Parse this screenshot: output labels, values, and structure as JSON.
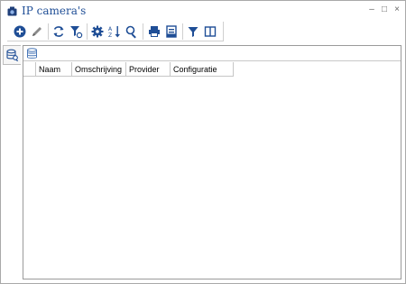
{
  "window": {
    "title": "IP camera's",
    "title_icon": "camera-icon",
    "controls": [
      "minimize-icon",
      "maximize-icon",
      "close-icon"
    ]
  },
  "toolbar": {
    "buttons": [
      "add-icon",
      "edit-icon",
      "refresh-icon",
      "filter-settings-icon",
      "settings-icon",
      "sort-az-icon",
      "search-icon",
      "print-icon",
      "print-preview-icon",
      "filter-icon",
      "columns-icon"
    ]
  },
  "sidebar": {
    "tab_icon": "database-search-icon"
  },
  "panel": {
    "icon": "database-icon"
  },
  "grid": {
    "columns": [
      "",
      "Naam",
      "Omschrijving",
      "Provider",
      "Configuratie"
    ],
    "rows": []
  },
  "colors": {
    "title": "#1f4e96",
    "icon_blue": "#1f4e96"
  }
}
